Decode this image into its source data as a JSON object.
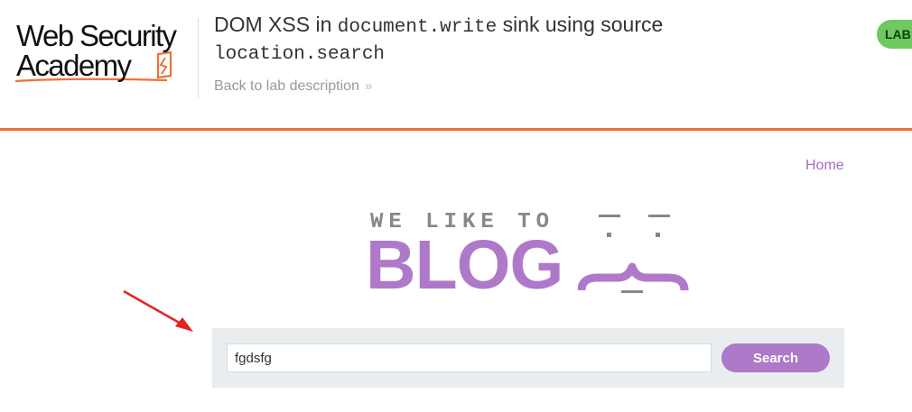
{
  "header": {
    "logo_line1": "Web Security",
    "logo_line2": "Academy",
    "title_prefix": "DOM XSS in ",
    "title_code1": "document.write",
    "title_mid": " sink using source ",
    "title_code2": "location.search",
    "back_link": "Back to lab description",
    "back_icon": "double-chevron-right-icon",
    "lab_status": "LAB"
  },
  "nav": {
    "home": "Home"
  },
  "blog_logo": {
    "tagline": "WE LIKE TO",
    "word": "BLOG"
  },
  "search": {
    "value": "fgdsfg",
    "button": "Search"
  },
  "colors": {
    "accent_orange": "#f0703a",
    "brand_purple": "#ae79c8",
    "status_green": "#6dc960",
    "annotation_red": "#e8231f"
  }
}
